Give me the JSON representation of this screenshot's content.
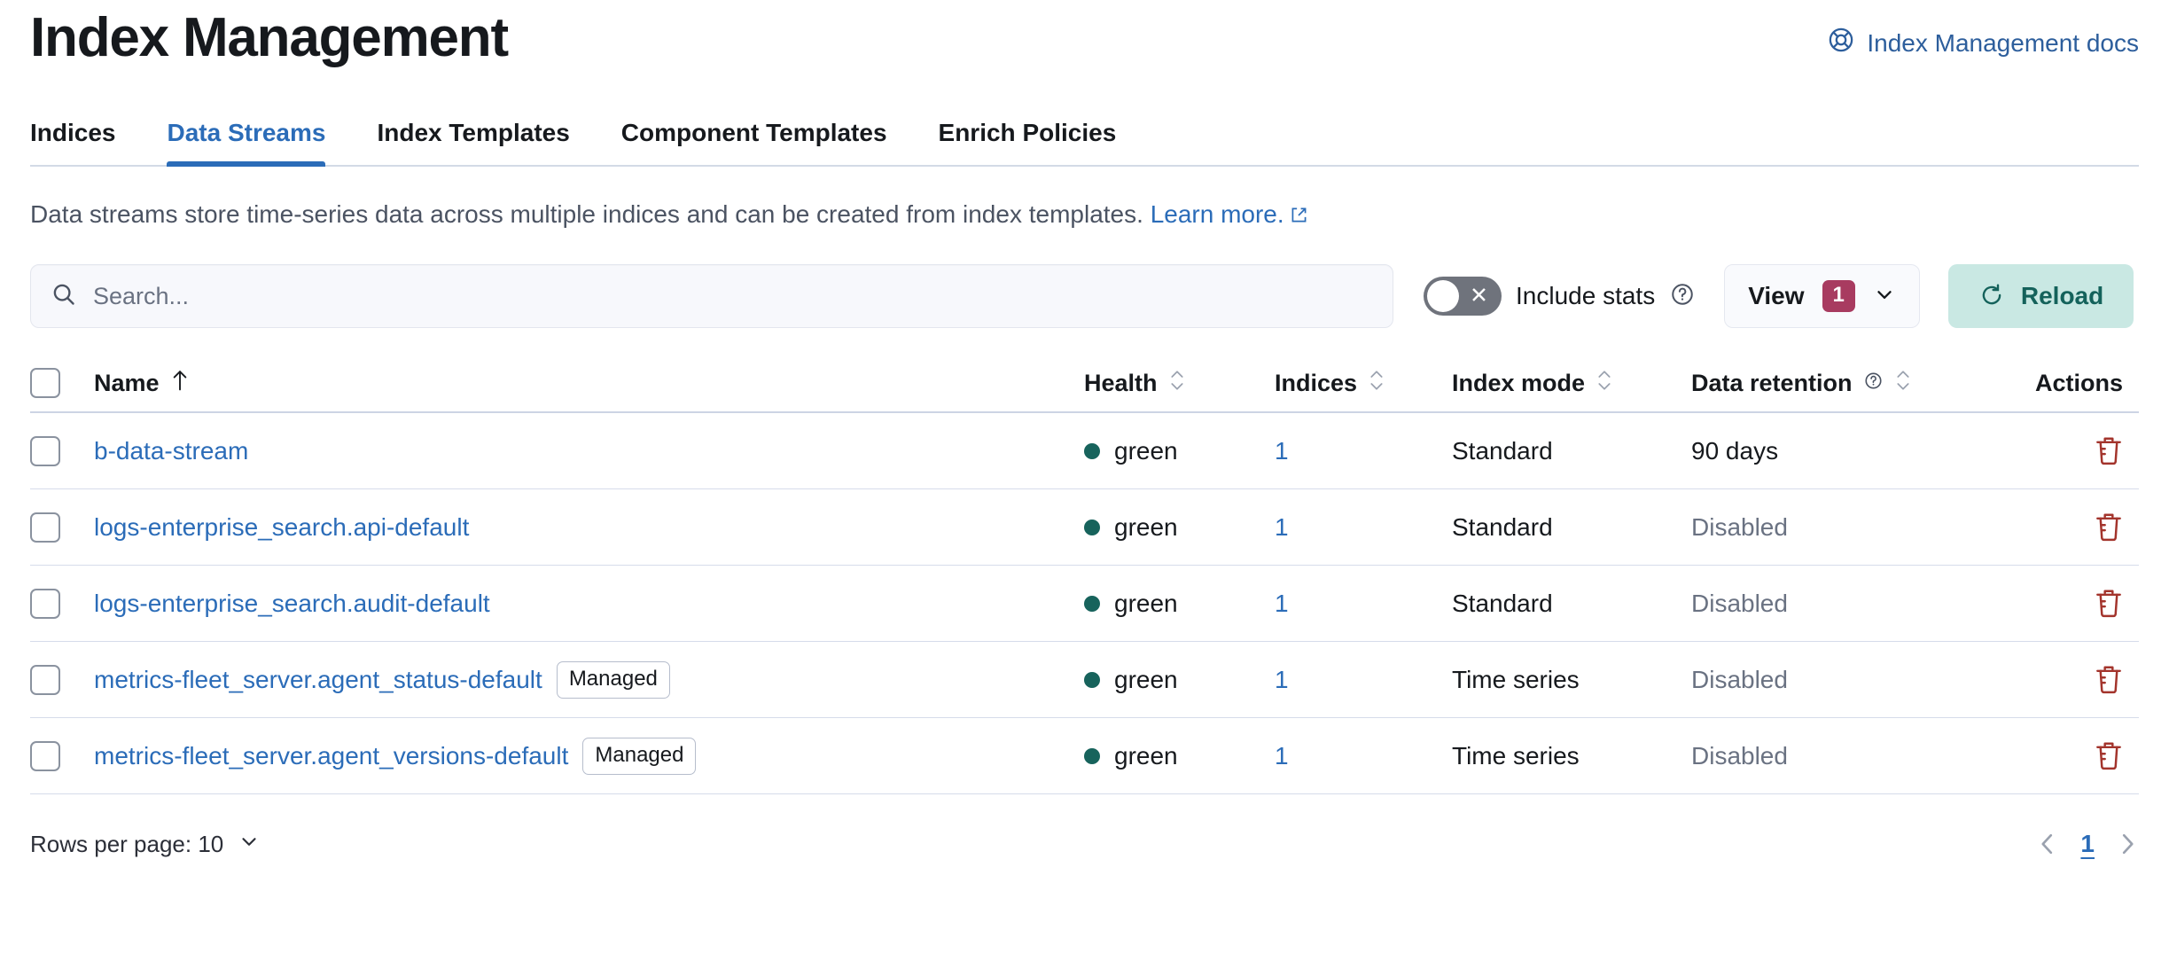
{
  "header": {
    "title": "Index Management",
    "docs_link": "Index Management docs",
    "docs_icon": "lifebuoy-help-icon"
  },
  "tabs": [
    {
      "label": "Indices",
      "active": false
    },
    {
      "label": "Data Streams",
      "active": true
    },
    {
      "label": "Index Templates",
      "active": false
    },
    {
      "label": "Component Templates",
      "active": false
    },
    {
      "label": "Enrich Policies",
      "active": false
    }
  ],
  "description": {
    "text": "Data streams store time-series data across multiple indices and can be created from index templates.",
    "link": "Learn more.",
    "link_icon": "external-link-icon"
  },
  "toolbar": {
    "search_placeholder": "Search...",
    "search_value": "",
    "search_icon": "search-icon",
    "include_stats_label": "Include stats",
    "include_stats_on": false,
    "include_stats_help_icon": "question-mark-circle-icon",
    "view_label": "View",
    "view_badge": "1",
    "view_chevron_icon": "chevron-down-icon",
    "reload_label": "Reload",
    "reload_icon": "refresh-icon"
  },
  "table": {
    "columns": [
      {
        "key": "name",
        "label": "Name",
        "sort": "asc",
        "help": false
      },
      {
        "key": "health",
        "label": "Health",
        "sort": "both",
        "help": false
      },
      {
        "key": "indices",
        "label": "Indices",
        "sort": "both",
        "help": false
      },
      {
        "key": "mode",
        "label": "Index mode",
        "sort": "both",
        "help": false
      },
      {
        "key": "retention",
        "label": "Data retention",
        "sort": "both",
        "help": true
      },
      {
        "key": "actions",
        "label": "Actions",
        "sort": "none",
        "help": false
      }
    ],
    "rows": [
      {
        "name": "b-data-stream",
        "managed": "",
        "health": "green",
        "indices": "1",
        "mode": "Standard",
        "retention": "90 days",
        "retention_muted": false,
        "action_icon": "trash-icon"
      },
      {
        "name": "logs-enterprise_search.api-default",
        "managed": "",
        "health": "green",
        "indices": "1",
        "mode": "Standard",
        "retention": "Disabled",
        "retention_muted": true,
        "action_icon": "trash-icon"
      },
      {
        "name": "logs-enterprise_search.audit-default",
        "managed": "",
        "health": "green",
        "indices": "1",
        "mode": "Standard",
        "retention": "Disabled",
        "retention_muted": true,
        "action_icon": "trash-icon"
      },
      {
        "name": "metrics-fleet_server.agent_status-default",
        "managed": "Managed",
        "health": "green",
        "indices": "1",
        "mode": "Time series",
        "retention": "Disabled",
        "retention_muted": true,
        "action_icon": "trash-icon"
      },
      {
        "name": "metrics-fleet_server.agent_versions-default",
        "managed": "Managed",
        "health": "green",
        "indices": "1",
        "mode": "Time series",
        "retention": "Disabled",
        "retention_muted": true,
        "action_icon": "trash-icon"
      }
    ]
  },
  "footer": {
    "rows_per_page_label": "Rows per page: 10",
    "rows_per_page_chevron": "chevron-down-icon",
    "prev_icon": "chevron-left-icon",
    "page_number": "1",
    "next_icon": "chevron-right-icon"
  },
  "colors": {
    "link": "#2b6cb8",
    "accent_tab": "#2b6cb8",
    "health_green": "#17635c",
    "badge_magenta": "#a83b60",
    "reload_bg": "#c9e8e3",
    "reload_text": "#14625b",
    "trash_red": "#a3342c",
    "muted_text": "#6a7282",
    "border": "#d6dcea"
  }
}
